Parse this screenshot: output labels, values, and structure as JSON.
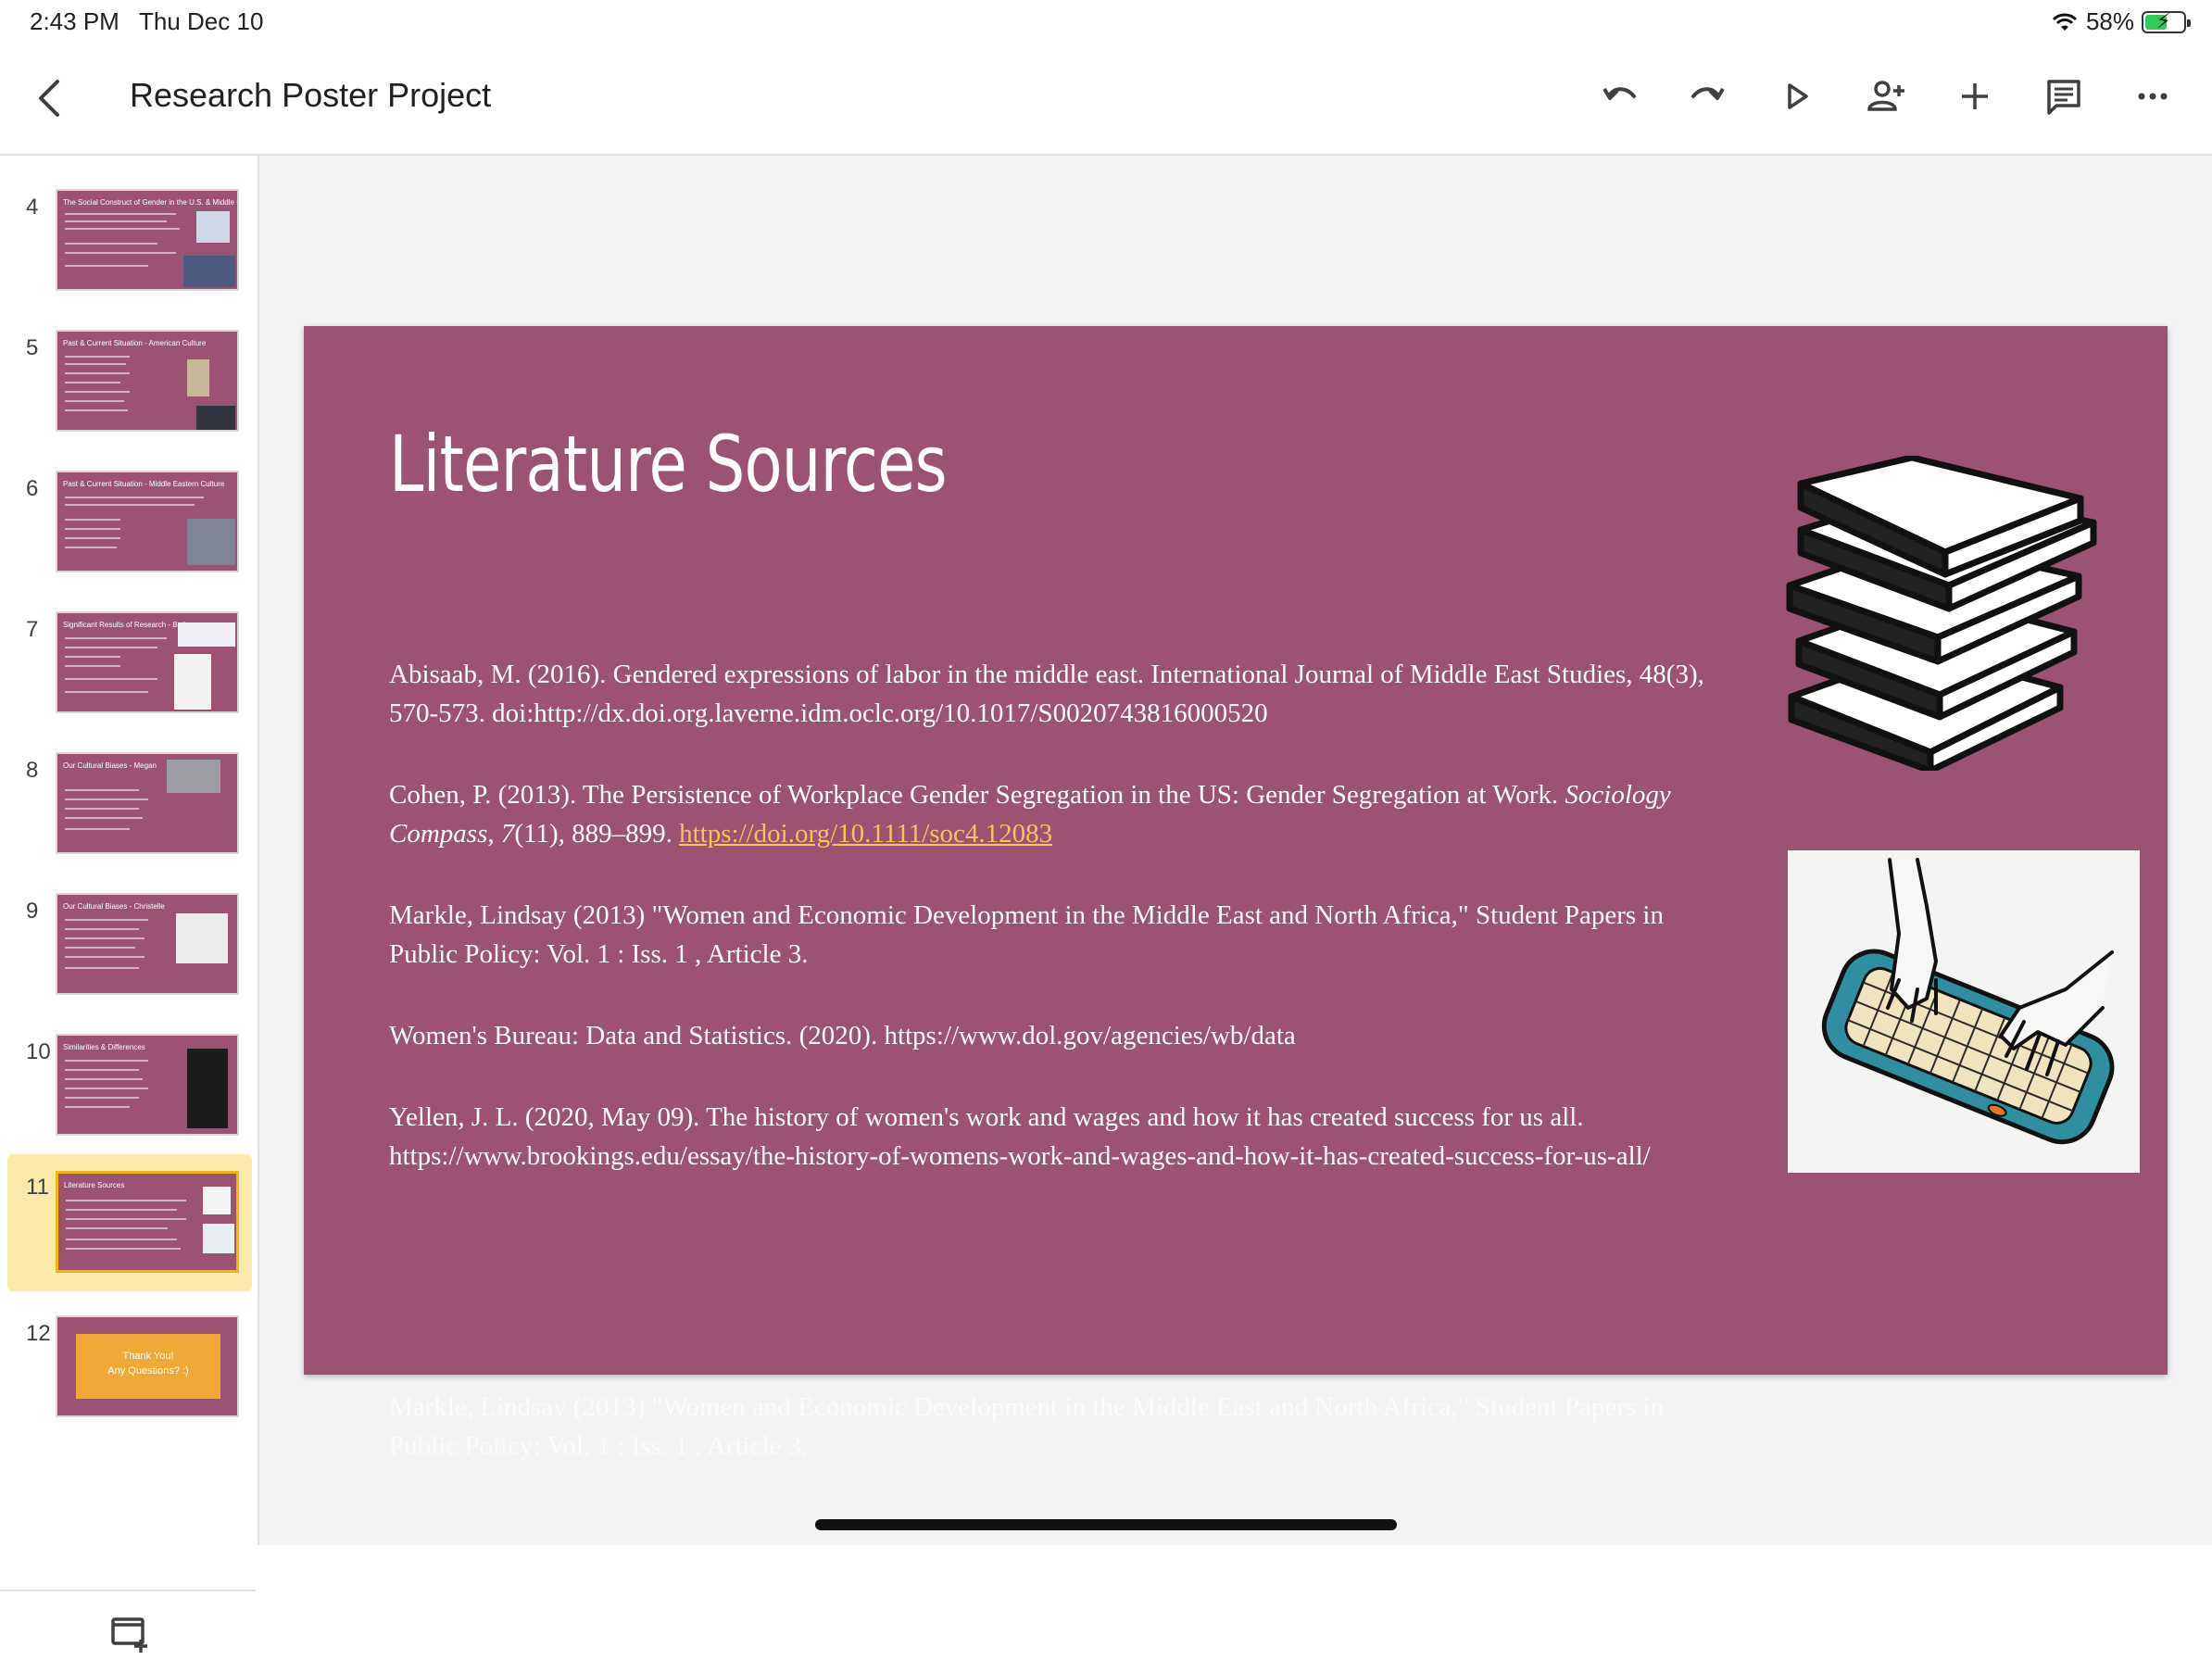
{
  "status": {
    "time": "2:43 PM",
    "date": "Thu Dec 10",
    "battery": "58%",
    "battery_level": 0.58
  },
  "toolbar": {
    "title": "Research Poster Project",
    "icons": [
      "back-icon",
      "undo-icon",
      "redo-icon",
      "present-icon",
      "add-person-icon",
      "add-icon",
      "comment-icon",
      "more-icon"
    ]
  },
  "sidebar": {
    "thumbnails": [
      {
        "num": "4",
        "title": "The Social Construct of Gender in the U.S. & Middle East"
      },
      {
        "num": "5",
        "title": "Past & Current Situation - American Culture"
      },
      {
        "num": "6",
        "title": "Past & Current Situation - Middle Eastern Culture"
      },
      {
        "num": "7",
        "title": "Significant Results of Research - Both"
      },
      {
        "num": "8",
        "title": "Our Cultural Biases - Megan"
      },
      {
        "num": "9",
        "title": "Our Cultural Biases - Christelle"
      },
      {
        "num": "10",
        "title": "Similarities & Differences"
      },
      {
        "num": "11",
        "title": "Literature Sources"
      },
      {
        "num": "12",
        "title": "Thank You!",
        "subtitle": "Any Questions? :)"
      }
    ],
    "selected_index": 7
  },
  "slide": {
    "title": "Literature Sources",
    "refs": {
      "r1": "Abisaab, M. (2016). Gendered expressions of labor in the middle east. International Journal of Middle East Studies, 48(3), 570-573. doi:http://dx.doi.org.laverne.idm.oclc.org/10.1017/S0020743816000520",
      "r2_text": "Cohen, P. (2013). The Persistence of Workplace Gender Segregation in the US: Gender Segregation at Work. ",
      "r2_journal": "Sociology Compass",
      "r2_sep": ", ",
      "r2_vol": "7",
      "r2_rest": "(11), 889–899. ",
      "r2_link": "https://doi.org/10.1111/soc4.12083",
      "r3": "Markle, Lindsay (2013) \"Women and Economic Development in the Middle East and North Africa,\" Student Papers in Public Policy: Vol. 1 : Iss. 1 , Article 3.",
      "r4": "Women's Bureau: Data and Statistics. (2020). https://www.dol.gov/agencies/wb/data",
      "r5": "Yellen, J. L. (2020, May 09). The history of women's work and wages and how it has created success for us all. https://www.brookings.edu/essay/the-history-of-womens-work-and-wages-and-how-it-has-created-success-for-us-all/"
    }
  },
  "ghost_text": "Markle, Lindsay (2013) \"Women and Economic Development in the Middle East and North Africa,\" Student Papers in Public Policy: Vol. 1 : Iss. 1 , Article 3.",
  "colors": {
    "slide_bg": "#9b5273",
    "link": "#f6c35c",
    "selected_thumb_bg": "#fbe9a9",
    "canvas_bg": "#f1f3f4"
  }
}
